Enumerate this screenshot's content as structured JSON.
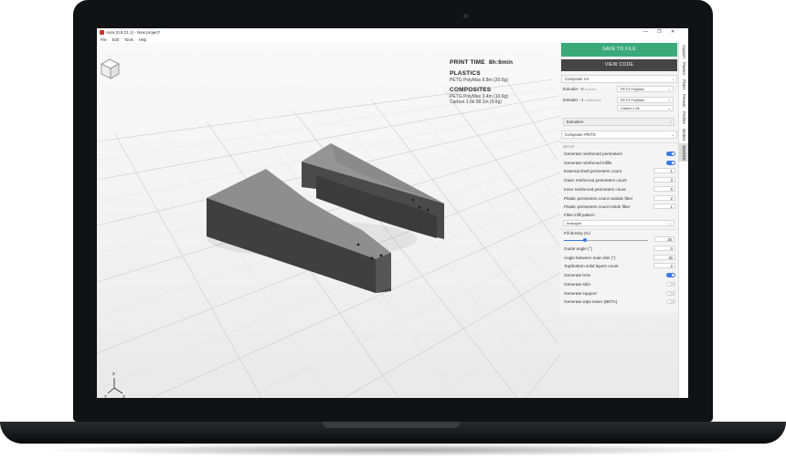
{
  "window": {
    "title": "Aura (0.8.21.1) - New project*",
    "controls": [
      "—",
      "❐",
      "✕"
    ]
  },
  "menu": [
    "File",
    "Edit",
    "Tools",
    "Help"
  ],
  "info": {
    "print_time_label": "PRINT TIME",
    "print_time": "8h:6min",
    "plastics_heading": "PLASTICS",
    "plastics_line": "PETG PolyMax  6.8m (20.6g)",
    "composites_heading": "COMPOSITES",
    "composites_lines": [
      "PETG PolyMax  3.4m (10.6g)",
      "Carbon 1.5k  58.1m (9.6g)"
    ]
  },
  "panel": {
    "save_label": "SAVE TO FILE",
    "code_label": "VIEW CODE",
    "printer": "Composer A4",
    "extruder0_label": "Extruder - 0",
    "extruder0_sub": "PLASTIC",
    "extruder0_material": "PETG PolyMax",
    "extruder1_label": "Extruder - 1",
    "extruder1_sub": "COMPOSITE",
    "extruder1_material": "PETG PolyMax",
    "extruder1_fiber": "Carbon 1.5k",
    "extruders_label": "Extruders",
    "profile": "Composer+PETG",
    "setup_label": "SETUP",
    "settings": [
      {
        "label": "Generate reinforced perimeters",
        "kind": "toggle",
        "on": true
      },
      {
        "label": "Generate reinforced infills",
        "kind": "toggle",
        "on": true
      },
      {
        "label": "External shell perimeters count",
        "kind": "num",
        "value": "1"
      },
      {
        "label": "Outer reinforced perimeters count",
        "kind": "num",
        "value": "3"
      },
      {
        "label": "Inner reinforced perimeters count",
        "kind": "num",
        "value": "0"
      },
      {
        "label": "Plastic perimeters count outside fiber",
        "kind": "num",
        "value": "2"
      },
      {
        "label": "Plastic perimeters count inside fiber",
        "kind": "num",
        "value": "1"
      }
    ],
    "fiber_pattern_label": "Fiber infill pattern",
    "fiber_pattern": "Anisogrid",
    "fill_density_label": "Fill density (%)",
    "fill_density": "25",
    "fill_density_fraction": 0.25,
    "settings2": [
      {
        "label": "Guide angle (°)",
        "kind": "num",
        "value": "0"
      },
      {
        "label": "Angle between main ribs (°)",
        "kind": "num",
        "value": "30"
      },
      {
        "label": "Top/bottom solid layers count",
        "kind": "num",
        "value": "2"
      },
      {
        "label": "Generate brim",
        "kind": "toggle",
        "on": true
      },
      {
        "label": "Generate skirt",
        "kind": "toggle",
        "on": false
      },
      {
        "label": "Generate support",
        "kind": "toggle",
        "on": false
      },
      {
        "label": "Generate wipe tower (BETA)",
        "kind": "toggle",
        "on": false
      }
    ]
  },
  "side_tabs": [
    "Support",
    "Plastics",
    "Fibers",
    "Presets",
    "Profiles",
    "Models",
    "SLICING"
  ],
  "axes": {
    "x": "X",
    "y": "Y",
    "z": "Z"
  },
  "colors": {
    "save": "#3aaa7b",
    "toggle_on": "#3b78e7",
    "model": "#6b6b6b"
  }
}
